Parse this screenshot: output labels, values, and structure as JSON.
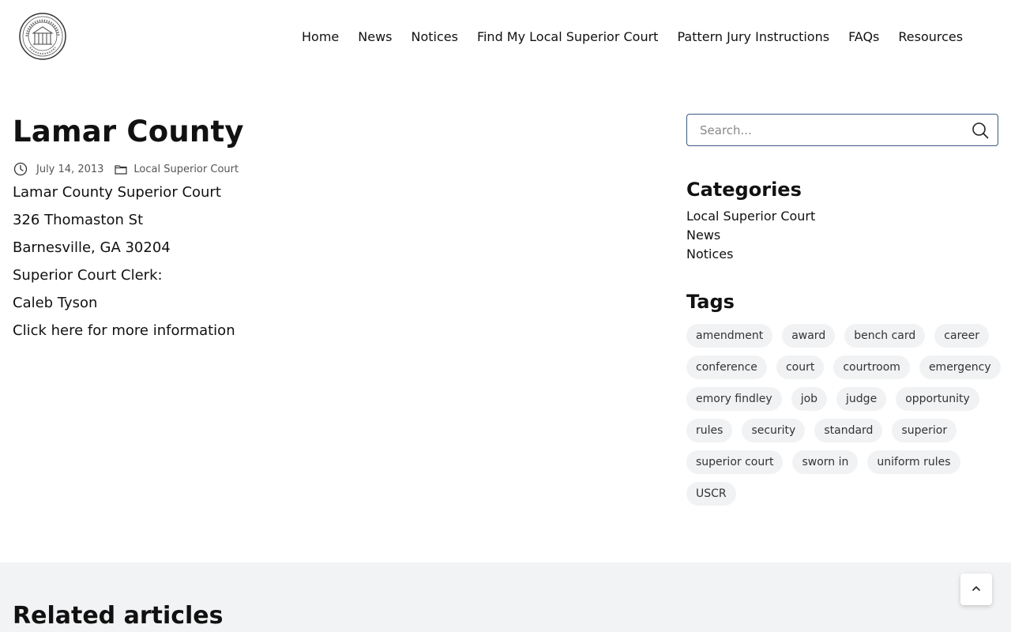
{
  "header": {
    "logo_alt": "State of Georgia seal",
    "nav": [
      {
        "label": "Home"
      },
      {
        "label": "News"
      },
      {
        "label": "Notices"
      },
      {
        "label": "Find My Local Superior Court"
      },
      {
        "label": "Pattern Jury Instructions"
      },
      {
        "label": "FAQs"
      },
      {
        "label": "Resources"
      }
    ]
  },
  "article": {
    "title": "Lamar County",
    "date": "July 14, 2013",
    "category": "Local Superior Court",
    "lines": [
      "Lamar County Superior Court",
      "326 Thomaston St",
      "Barnesville, GA 30204",
      "Superior Court Clerk:",
      "Caleb Tyson"
    ],
    "more_link": "Click here for more information"
  },
  "sidebar": {
    "search": {
      "placeholder": "Search..."
    },
    "categories_title": "Categories",
    "categories": [
      "Local Superior Court",
      "News",
      "Notices"
    ],
    "tags_title": "Tags",
    "tags": [
      "amendment",
      "award",
      "bench card",
      "career",
      "conference",
      "court",
      "courtroom",
      "emergency",
      "emory findley",
      "job",
      "judge",
      "opportunity",
      "rules",
      "security",
      "standard",
      "superior",
      "superior court",
      "sworn in",
      "uniform rules",
      "USCR"
    ]
  },
  "related": {
    "title": "Related articles"
  },
  "icons": {
    "clock": "clock-icon",
    "folder": "folder-icon",
    "search": "search-icon",
    "chevron_up": "chevron-up-icon"
  }
}
